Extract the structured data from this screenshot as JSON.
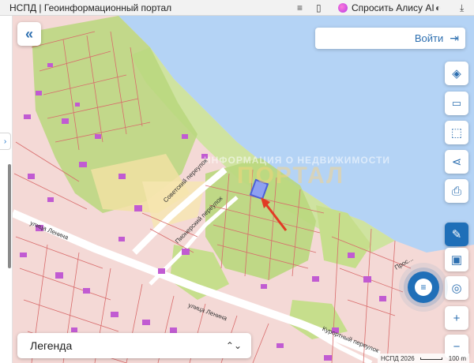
{
  "browser": {
    "tab_title": "НСПД | Геоинформационный портал",
    "alice_label": "Спросить Алису AI"
  },
  "header": {
    "login_label": "Войти"
  },
  "legend": {
    "label": "Легенда"
  },
  "map": {
    "watermark_small": "ИНФОРМАЦИЯ О НЕДВИЖИМОСТИ",
    "watermark_big": "ПОРТАЛ",
    "streets": {
      "lenina": "улица Ленина",
      "sovetsky": "Советский переулок",
      "pionersky": "Пионерский переулок",
      "kurortny": "Курортный переулок",
      "lenina2": "улица Ленина",
      "prospekt": "Прос..."
    },
    "scale_label": "100 m",
    "attribution": "НСПД 2026",
    "colors": {
      "water": "#b4d3f5",
      "parcel_fill": "#f5d3d0",
      "parcel_line": "#d86b6b",
      "green": "#b9d77d",
      "yellow": "#f1e2a2",
      "building": "#c15bd2",
      "highlight": "#4b5fd8",
      "arrow": "#e23b24"
    }
  },
  "toolbar": {
    "layers_icon": "layers-icon",
    "ruler_icon": "ruler-icon",
    "select_icon": "select-area-icon",
    "share_icon": "share-icon",
    "print_icon": "print-icon",
    "zoom_in": "+",
    "zoom_out": "−"
  }
}
